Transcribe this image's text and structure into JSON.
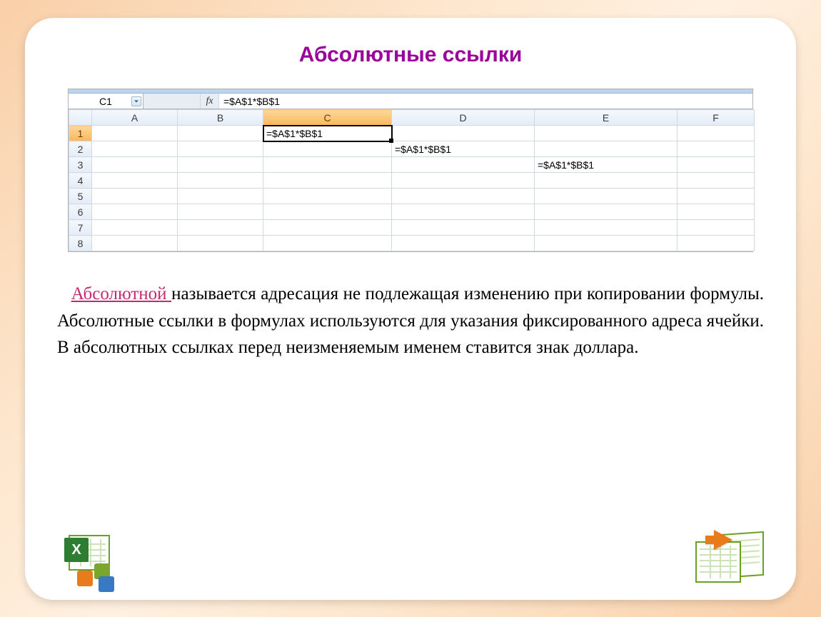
{
  "title": "Абсолютные ссылки",
  "formula_bar": {
    "name_box": "C1",
    "fx_label": "fx",
    "formula": "=$A$1*$B$1"
  },
  "columns": [
    "A",
    "B",
    "C",
    "D",
    "E",
    "F"
  ],
  "rows": [
    "1",
    "2",
    "3",
    "4",
    "5",
    "6",
    "7",
    "8"
  ],
  "active": {
    "col": "C",
    "row": "1"
  },
  "cells": {
    "C1": "=$A$1*$B$1",
    "D2": "=$A$1*$B$1",
    "E3": "=$A$1*$B$1"
  },
  "paragraph": {
    "keyword": "Абсолютной ",
    "rest": "называется адресация не подлежащая изменению при копировании формулы. Абсолютные ссылки в формулах используются для указания фиксированного адреса ячейки. В абсолютных ссылках перед неизменяемым именем ставится знак доллара."
  },
  "icons": {
    "excel_x": "X"
  }
}
